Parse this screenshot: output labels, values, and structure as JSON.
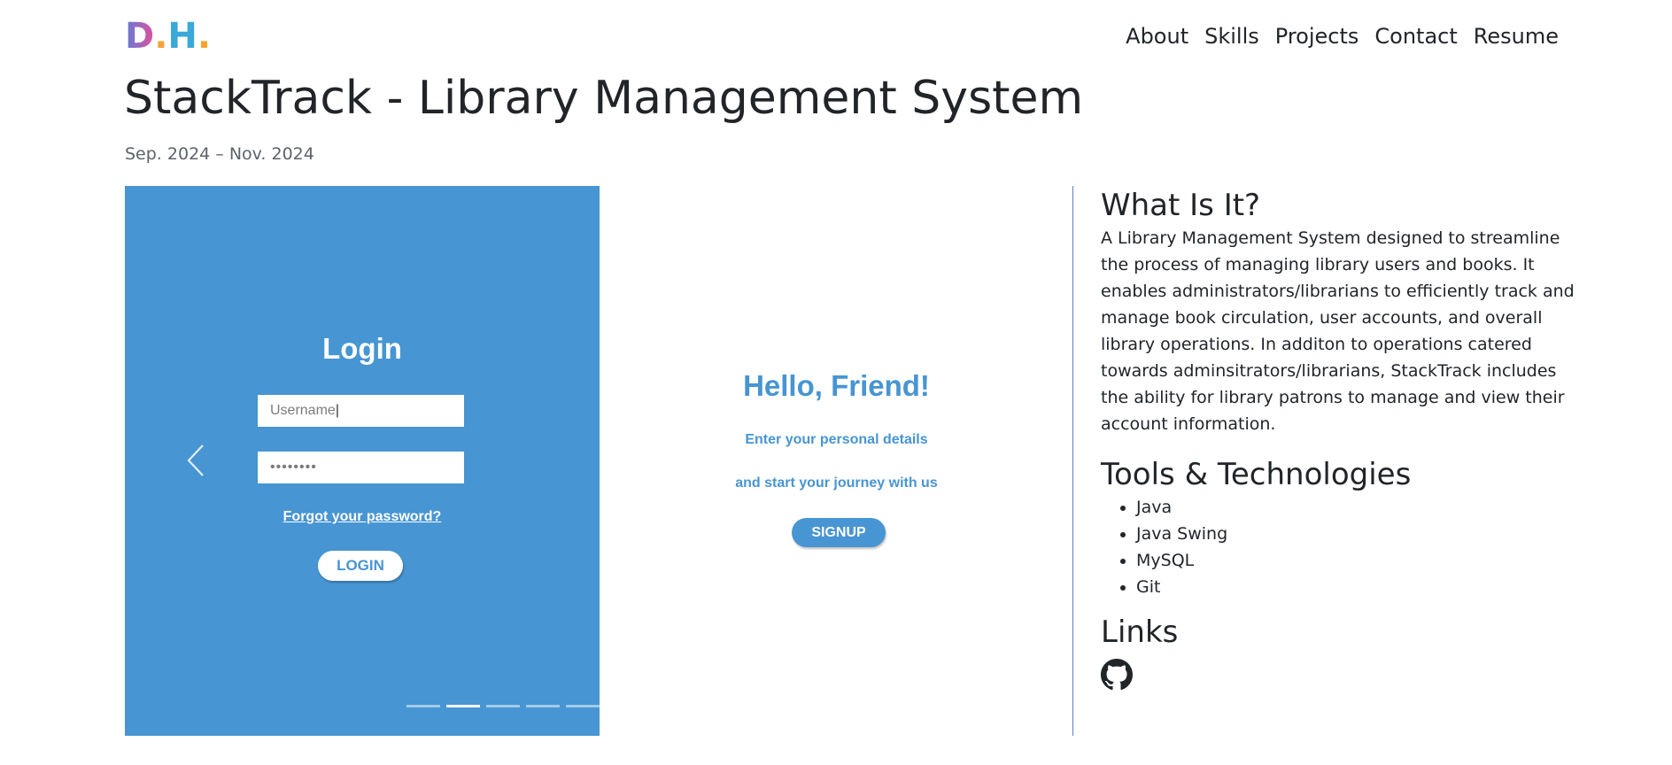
{
  "header": {
    "logo": [
      "D",
      ".",
      "H",
      "."
    ],
    "logo_colors": [
      "#ee4a8a",
      "#f6a23c",
      "#3aa8d8",
      "#f7cc3a"
    ],
    "logo_gradient_d": [
      "#5f7ed8",
      "#e24f9a"
    ],
    "nav": [
      "About",
      "Skills",
      "Projects",
      "Contact",
      "Resume"
    ]
  },
  "page": {
    "title": "StackTrack - Library Management System",
    "date": "Sep. 2024 – Nov. 2024"
  },
  "carousel": {
    "accent": "#4795d2",
    "login_title": "Login",
    "username_value": "Username",
    "password_value": "••••••••",
    "forgot": "Forgot your password?",
    "login_button": "LOGIN",
    "hello": "Hello, Friend!",
    "sub1": "Enter your personal details",
    "sub2": "and start your journey with us",
    "signup_button": "SIGNUP",
    "prev_icon": "chevron-left-icon",
    "indicator_count": 5,
    "active_indicator": 2
  },
  "aside": {
    "what_heading": "What Is It?",
    "what_text": "A Library Management System designed to streamline the process of managing library users and books. It enables administrators/librarians to efficiently track and manage book circulation, user accounts, and overall library operations. In additon to operations catered towards adminsitrators/librarians, StackTrack includes the ability for library patrons to manage and view their account information.",
    "tools_heading": "Tools & Technologies",
    "tools": [
      "Java",
      "Java Swing",
      "MySQL",
      "Git"
    ],
    "links_heading": "Links",
    "link_icon": "github-icon"
  }
}
